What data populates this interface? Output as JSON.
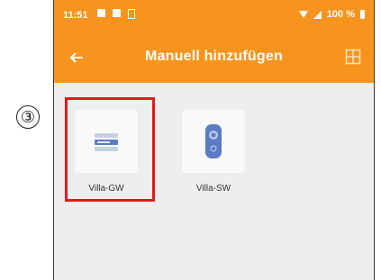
{
  "annotation": {
    "step_marker": "③",
    "highlight_color": "#e01b1b"
  },
  "status_bar": {
    "time": "11:51",
    "battery_text": "100 %",
    "icons": [
      "message-icon",
      "message-icon",
      "sim-icon",
      "wifi-icon",
      "signal-icon",
      "battery-icon"
    ]
  },
  "app_bar": {
    "title": "Manuell hinzufügen",
    "back_icon": "arrow-left-icon",
    "action_icon": "scan-icon",
    "color": "#f7941d"
  },
  "devices": [
    {
      "label": "Villa-GW",
      "icon": "gateway-icon",
      "selected": true
    },
    {
      "label": "Villa-SW",
      "icon": "switch-icon",
      "selected": false
    }
  ]
}
